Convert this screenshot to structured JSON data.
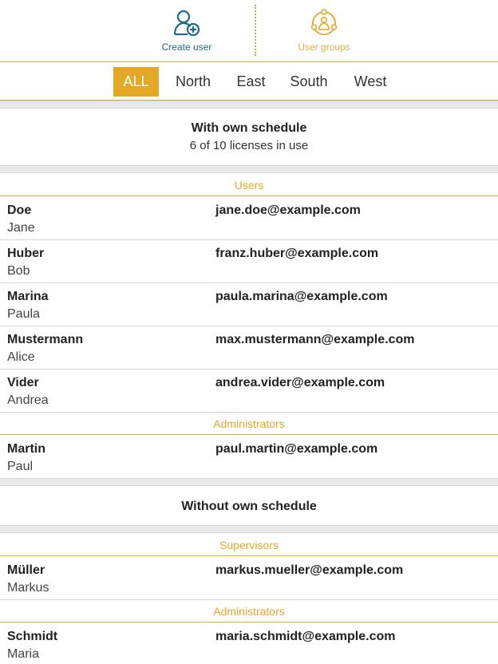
{
  "toolbar": {
    "create_user_label": "Create user",
    "user_groups_label": "User groups",
    "create_color": "#1e6a8a",
    "groups_color": "#e3b03d"
  },
  "tabs": [
    {
      "label": "ALL",
      "active": true
    },
    {
      "label": "North",
      "active": false
    },
    {
      "label": "East",
      "active": false
    },
    {
      "label": "South",
      "active": false
    },
    {
      "label": "West",
      "active": false
    }
  ],
  "sections": {
    "with_schedule": {
      "title": "With own schedule",
      "subtitle": "6 of 10 licenses in use",
      "groups": [
        {
          "label": "Users",
          "rows": [
            {
              "last": "Doe",
              "first": "Jane",
              "email": "jane.doe@example.com"
            },
            {
              "last": "Huber",
              "first": "Bob",
              "email": "franz.huber@example.com"
            },
            {
              "last": "Marina",
              "first": "Paula",
              "email": "paula.marina@example.com"
            },
            {
              "last": "Mustermann",
              "first": "Alice",
              "email": "max.mustermann@example.com"
            },
            {
              "last": "Vider",
              "first": "Andrea",
              "email": "andrea.vider@example.com"
            }
          ]
        },
        {
          "label": "Administrators",
          "rows": [
            {
              "last": "Martin",
              "first": "Paul",
              "email": "paul.martin@example.com"
            }
          ]
        }
      ]
    },
    "without_schedule": {
      "title": "Without own schedule",
      "groups": [
        {
          "label": "Supervisors",
          "rows": [
            {
              "last": "Müller",
              "first": "Markus",
              "email": "markus.mueller@example.com"
            }
          ]
        },
        {
          "label": "Administrators",
          "rows": [
            {
              "last": "Schmidt",
              "first": "Maria",
              "email": "maria.schmidt@example.com"
            }
          ]
        }
      ]
    }
  },
  "colors": {
    "accent": "#e3a924",
    "divider": "#e3b03d",
    "section_gap": "#e9e9e9"
  }
}
